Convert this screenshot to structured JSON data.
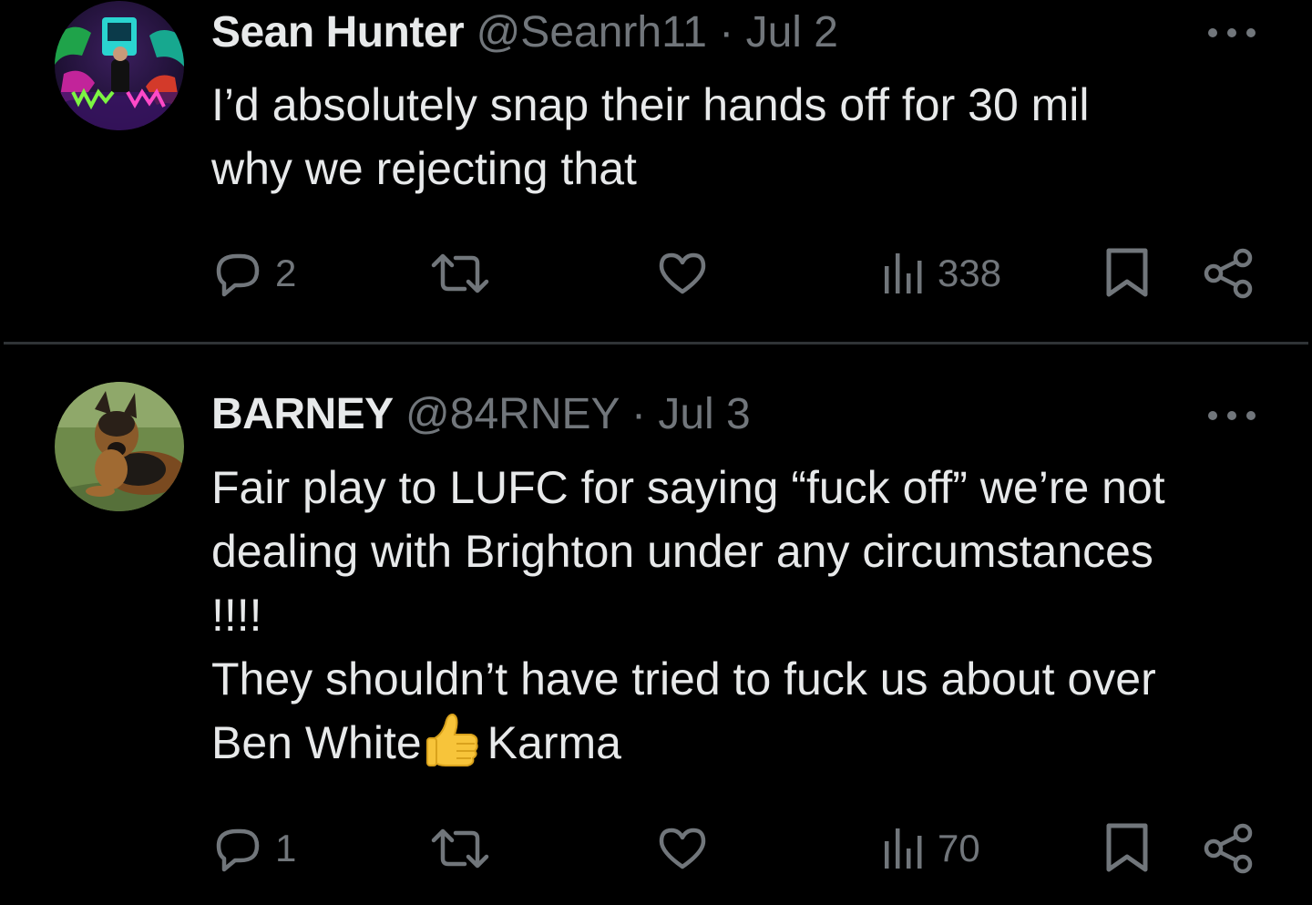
{
  "tweets": [
    {
      "display_name": "Sean Hunter",
      "handle": "@Seanrh11",
      "separator": "·",
      "date": "Jul 2",
      "body_lines": [
        "I’d absolutely snap their hands off for 30 mil",
        "why we rejecting that"
      ],
      "replies": "2",
      "retweets": "",
      "likes": "",
      "views": "338",
      "avatar": "neon-room-photo"
    },
    {
      "display_name": "BARNEY",
      "handle": "@84RNEY",
      "separator": "·",
      "date": "Jul 3",
      "body_lines": [
        "Fair play to LUFC for saying “fuck off” we’re not",
        "dealing with Brighton under any circumstances",
        "!!!!",
        "They shouldn’t have tried to fuck us about over"
      ],
      "body_last_before": "Ben White",
      "body_last_emoji": "thumbs-up-emoji",
      "body_last_after": "Karma",
      "replies": "1",
      "retweets": "",
      "likes": "",
      "views": "70",
      "avatar": "dog-photo"
    }
  ],
  "icons": {
    "reply": "reply-icon",
    "retweet": "retweet-icon",
    "like": "heart-icon",
    "views": "views-icon",
    "bookmark": "bookmark-icon",
    "share": "share-icon",
    "more": "more-icon"
  },
  "colors": {
    "background": "#000000",
    "text": "#e7e9ea",
    "muted": "#71767b",
    "divider": "#2f3336"
  }
}
